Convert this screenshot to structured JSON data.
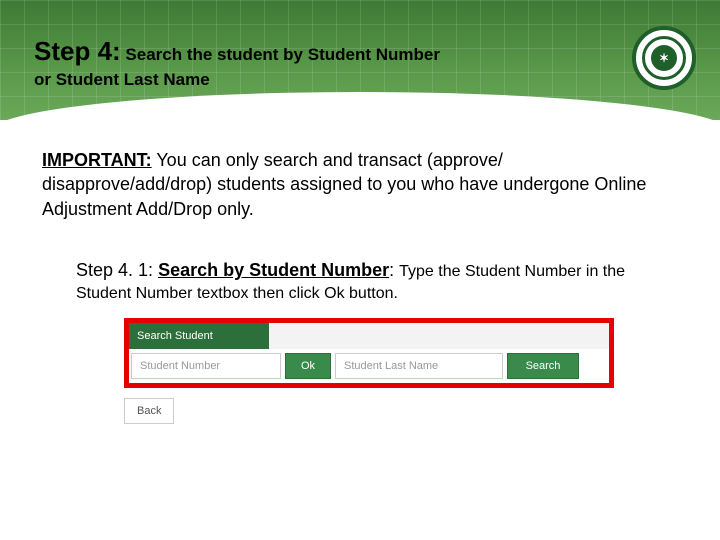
{
  "title": {
    "step_label": "Step 4:",
    "line1_rest": " Search the student by Student Number",
    "line2": "or Student Last Name"
  },
  "important": {
    "lead": "IMPORTANT:",
    "body": "  You can only search and transact (approve/ disapprove/add/drop) students assigned to you who have undergone Online Adjustment Add/Drop only."
  },
  "substep": {
    "head_plain": "Step 4. 1: ",
    "head_udl": "Search by Student Number",
    "head_tail": ":  ",
    "body": "Type the Student Number in the Student Number textbox then click Ok button."
  },
  "widget": {
    "header": "Search Student",
    "student_number_placeholder": "Student Number",
    "ok_label": "Ok",
    "lastname_placeholder": "Student Last Name",
    "search_label": "Search",
    "back_label": "Back"
  },
  "seal": {
    "glyph": "✶"
  }
}
